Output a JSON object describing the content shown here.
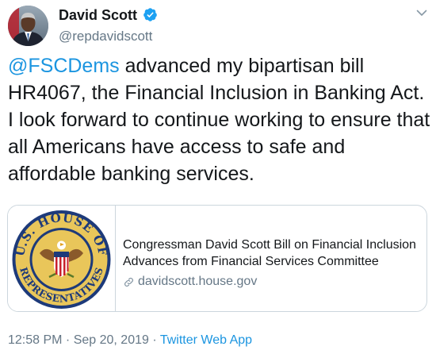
{
  "user": {
    "display_name": "David Scott",
    "handle": "@repdavidscott",
    "verified": true
  },
  "tweet": {
    "mention": "@FSCDems",
    "text_rest": " advanced my bipartisan bill HR4067, the Financial Inclusion in Banking Act. I look forward to continue working to ensure that all Americans have access to safe and affordable banking services."
  },
  "card": {
    "seal_top_text": "U.S. HOUSE OF",
    "seal_bottom_text": "REPRESENTATIVES",
    "title": "Congressman David Scott Bill on Financial Inclusion Advances from Financial Services Committee",
    "domain": "davidscott.house.gov"
  },
  "meta": {
    "time": "12:58 PM",
    "separator": " · ",
    "date": "Sep 20, 2019",
    "source": "Twitter Web App"
  },
  "colors": {
    "link_blue": "#1b95e0",
    "verified_blue": "#1da1f2",
    "secondary_text": "#657786",
    "border": "#ccd6dd"
  },
  "icons": [
    "avatar",
    "verified-badge-icon",
    "chevron-down-icon",
    "house-seal-logo",
    "link-icon"
  ]
}
